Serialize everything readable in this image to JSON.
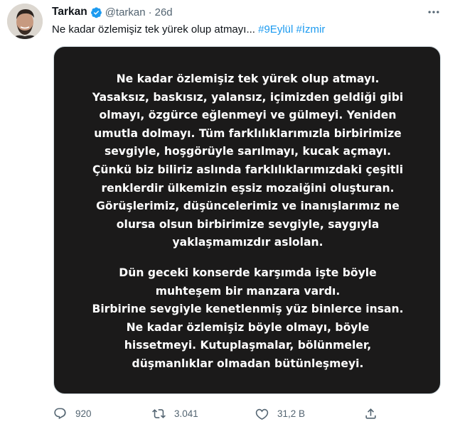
{
  "author": {
    "name": "Tarkan",
    "handle": "@tarkan",
    "separator": "·",
    "time": "26d",
    "verified": true
  },
  "tweet": {
    "text": "Ne kadar özlemişiz tek yürek olup atmayı...",
    "hashtags": [
      "#9Eylül",
      "#İzmir"
    ]
  },
  "image_text": {
    "paragraph_1": [
      "Ne kadar özlemişiz tek yürek olup atmayı.",
      "Yasaksız, baskısız, yalansız, içimizden geldiği gibi",
      "olmayı, özgürce eğlenmeyi ve gülmeyi. Yeniden",
      "umutla dolmayı. Tüm farklılıklarımızla birbirimize",
      "sevgiyle, hoşgörüyle sarılmayı, kucak açmayı.",
      "Çünkü biz biliriz aslında farklılıklarımızdaki çeşitli",
      "renklerdir ülkemizin eşsiz mozaiğini oluşturan.",
      "Görüşlerimiz, düşüncelerimiz ve inanışlarımız ne",
      "olursa olsun birbirimize sevgiyle, saygıyla",
      "yaklaşmamızdır aslolan."
    ],
    "paragraph_2": [
      "Dün geceki konserde karşımda işte böyle",
      "muhteşem bir manzara vardı.",
      "Birbirine sevgiyle kenetlenmiş yüz binlerce insan.",
      "Ne kadar özlemişiz böyle olmayı, böyle",
      "hissetmeyi. Kutuplaşmalar, bölünmeler,",
      "düşmanlıklar olmadan bütünleşmeyi."
    ]
  },
  "actions": {
    "reply_count": "920",
    "retweet_count": "3.041",
    "like_count": "31,2 B"
  },
  "icons": [
    "verified-badge-icon",
    "more-options-icon",
    "reply-icon",
    "retweet-icon",
    "like-icon",
    "share-icon"
  ],
  "colors": {
    "accent": "#1d9bf0",
    "text": "#0f1419",
    "secondary": "#536471",
    "image_background": "#1b1a1a"
  }
}
